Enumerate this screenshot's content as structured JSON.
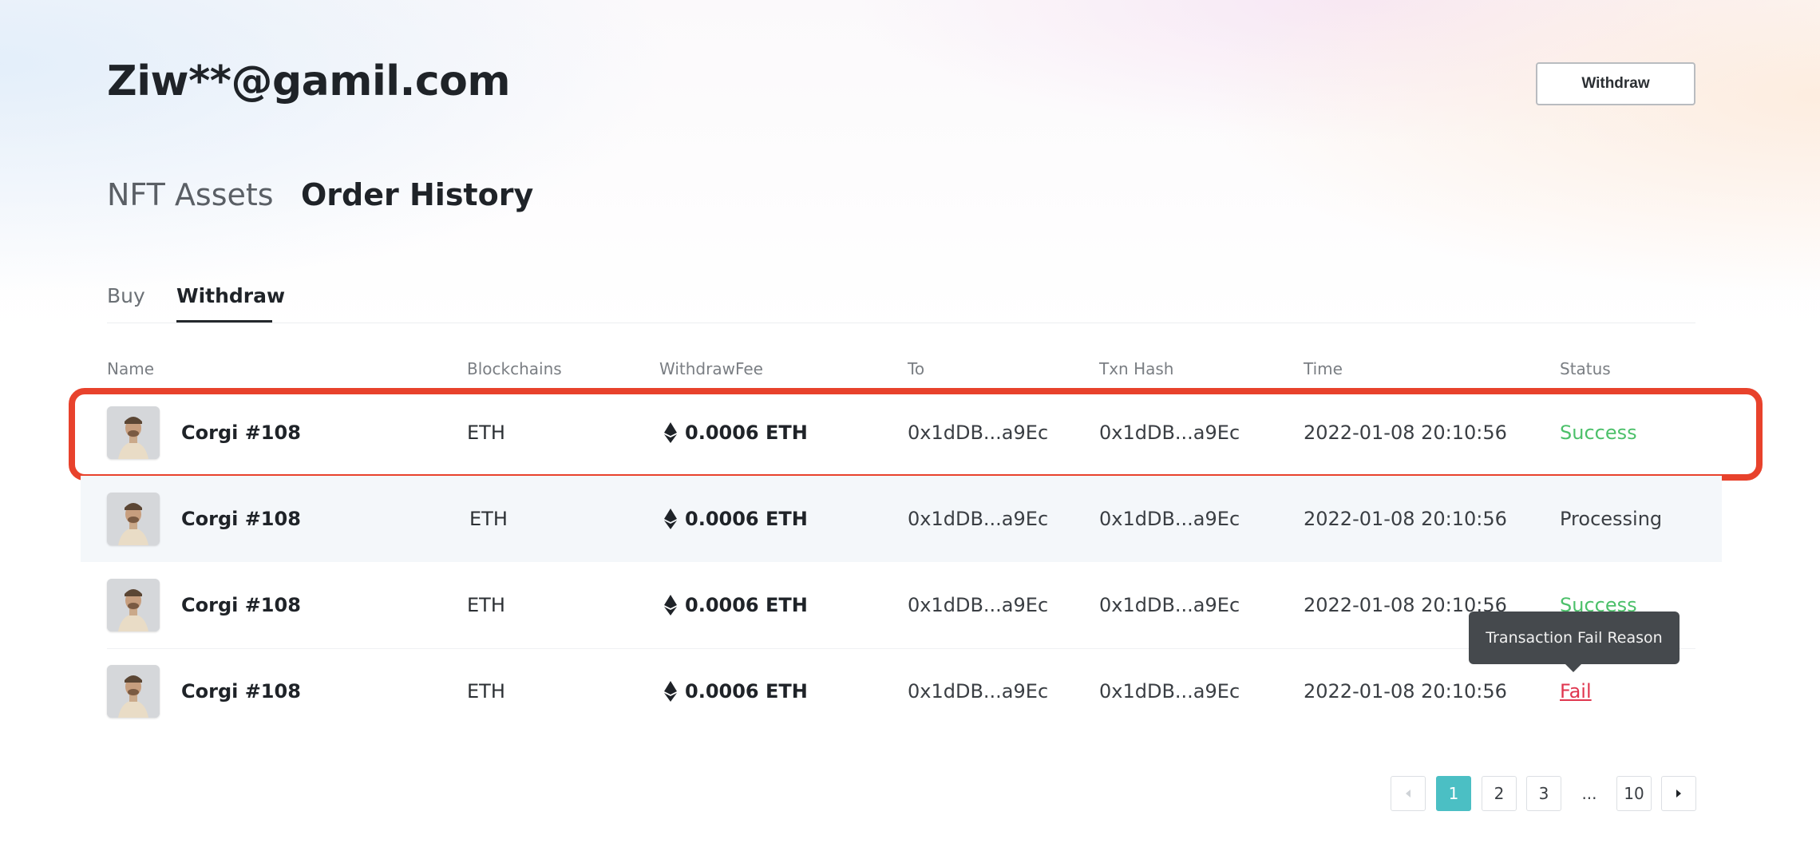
{
  "header": {
    "user": "Ziw**@gamil.com",
    "withdraw_label": "Withdraw"
  },
  "section_tabs": [
    {
      "label": "NFT Assets",
      "active": false
    },
    {
      "label": "Order History",
      "active": true
    }
  ],
  "sub_tabs": [
    {
      "label": "Buy",
      "active": false
    },
    {
      "label": "Withdraw",
      "active": true
    }
  ],
  "columns": [
    "Name",
    "Blockchains",
    "WithdrawFee",
    "To",
    "Txn Hash",
    "Time",
    "Status"
  ],
  "rows": [
    {
      "name": "Corgi #108",
      "chain": "ETH",
      "fee": "0.0006 ETH",
      "to": "0x1dDB...a9Ec",
      "hash": "0x1dDB...a9Ec",
      "time": "2022-01-08 20:10:56",
      "status": "Success"
    },
    {
      "name": "Corgi #108",
      "chain": "ETH",
      "fee": "0.0006 ETH",
      "to": "0x1dDB...a9Ec",
      "hash": "0x1dDB...a9Ec",
      "time": "2022-01-08 20:10:56",
      "status": "Processing"
    },
    {
      "name": "Corgi #108",
      "chain": "ETH",
      "fee": "0.0006 ETH",
      "to": "0x1dDB...a9Ec",
      "hash": "0x1dDB...a9Ec",
      "time": "2022-01-08 20:10:56",
      "status": "Success"
    },
    {
      "name": "Corgi #108",
      "chain": "ETH",
      "fee": "0.0006 ETH",
      "to": "0x1dDB...a9Ec",
      "hash": "0x1dDB...a9Ec",
      "time": "2022-01-08 20:10:56",
      "status": "Fail"
    }
  ],
  "tooltip": "Transaction Fail Reason",
  "pagination": {
    "pages": [
      "1",
      "2",
      "3",
      "10"
    ],
    "ellipsis": "...",
    "current": "1"
  },
  "icons": {
    "currency": "eth-icon",
    "avatar": "corgi-avatar-icon",
    "prev": "caret-left-icon",
    "next": "caret-right-icon"
  },
  "colors": {
    "success": "#4cc06a",
    "fail": "#e0364f",
    "accent": "#4bbfc4",
    "highlight": "#e8422c"
  }
}
